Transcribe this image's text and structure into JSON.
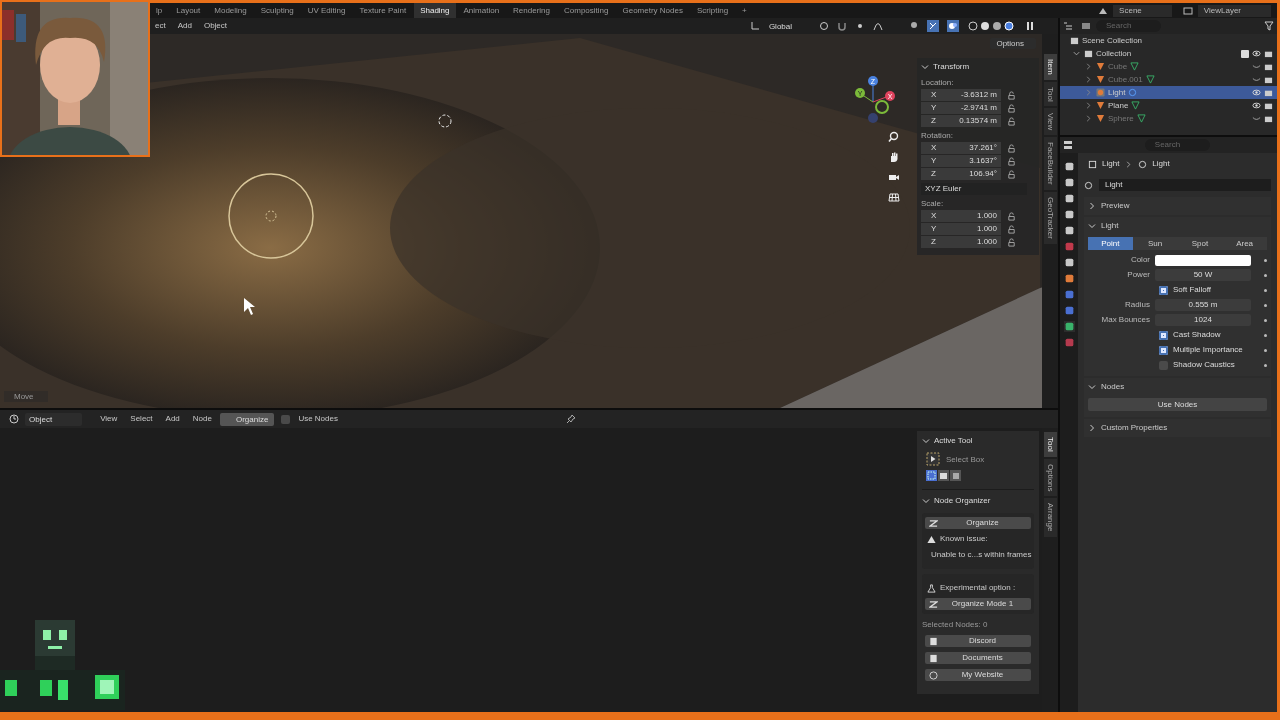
{
  "top_menu_fragment": "lp",
  "workspace_tabs": [
    {
      "label": "Layout",
      "selected": false
    },
    {
      "label": "Modeling",
      "selected": false
    },
    {
      "label": "Sculpting",
      "selected": false
    },
    {
      "label": "UV Editing",
      "selected": false
    },
    {
      "label": "Texture Paint",
      "selected": false
    },
    {
      "label": "Shading",
      "selected": true
    },
    {
      "label": "Animation",
      "selected": false
    },
    {
      "label": "Rendering",
      "selected": false
    },
    {
      "label": "Compositing",
      "selected": false
    },
    {
      "label": "Geometry Nodes",
      "selected": false
    },
    {
      "label": "Scripting",
      "selected": false
    }
  ],
  "add_tab": "+",
  "scene": "Scene",
  "view_layer": "ViewLayer",
  "viewport": {
    "menu": [
      "ect",
      "Add",
      "Object"
    ],
    "orientation": "Global",
    "options": "Options",
    "operator": "Move",
    "gizmo_axes": [
      "Z",
      "Y",
      "X"
    ],
    "transform": {
      "title": "Transform",
      "expanded": true,
      "location_label": "Location:",
      "location": [
        {
          "axis": "X",
          "value": "-3.6312 m"
        },
        {
          "axis": "Y",
          "value": "-2.9741 m"
        },
        {
          "axis": "Z",
          "value": "0.13574 m"
        }
      ],
      "rotation_label": "Rotation:",
      "rotation": [
        {
          "axis": "X",
          "value": "37.261°"
        },
        {
          "axis": "Y",
          "value": "3.1637°"
        },
        {
          "axis": "Z",
          "value": "106.94°"
        }
      ],
      "rotation_mode": "XYZ Euler",
      "scale_label": "Scale:",
      "scale": [
        {
          "axis": "X",
          "value": "1.000"
        },
        {
          "axis": "Y",
          "value": "1.000"
        },
        {
          "axis": "Z",
          "value": "1.000"
        }
      ]
    },
    "side_tabs": [
      {
        "label": "Item",
        "selected": true
      },
      {
        "label": "Tool",
        "selected": false
      },
      {
        "label": "View",
        "selected": false
      },
      {
        "label": "FaceBuilder",
        "selected": false
      },
      {
        "label": "GeoTracker",
        "selected": false
      }
    ]
  },
  "node_editor": {
    "editor_type": "Object",
    "menu": [
      "View",
      "Select",
      "Add",
      "Node"
    ],
    "organize": {
      "label": "Organize",
      "selected": true
    },
    "use_nodes": {
      "label": "Use Nodes",
      "checked": false
    },
    "active_tool": {
      "title": "Active Tool",
      "expanded": true,
      "tool": "Select Box"
    },
    "node_organizer": {
      "title": "Node Organizer",
      "expanded": true,
      "organize": "Organize",
      "issue_title": "Known issue:",
      "issue_text": "Unable to c...s within frames",
      "experimental": "Experimental option :",
      "mode_button": "Organize Mode 1",
      "selected_nodes": "Selected Nodes: 0",
      "links": [
        "Discord",
        "Documents",
        "My Website"
      ]
    },
    "side_tabs": [
      {
        "label": "Tool",
        "selected": true
      },
      {
        "label": "Options",
        "selected": false
      },
      {
        "label": "Arrange",
        "selected": false
      }
    ]
  },
  "outliner": {
    "search_placeholder": "Search",
    "scene_collection": "Scene Collection",
    "collection": "Collection",
    "collection_checked": true,
    "objects": [
      {
        "name": "Cube",
        "kind": "mesh",
        "visible": false,
        "selected": false
      },
      {
        "name": "Cube.001",
        "kind": "mesh",
        "visible": false,
        "selected": false
      },
      {
        "name": "Light",
        "kind": "light",
        "visible": true,
        "selected": true
      },
      {
        "name": "Plane",
        "kind": "mesh",
        "visible": true,
        "selected": false
      },
      {
        "name": "Sphere",
        "kind": "mesh",
        "visible": false,
        "selected": false
      }
    ]
  },
  "properties": {
    "search_placeholder": "Search",
    "breadcrumb": [
      "Light",
      "Light"
    ],
    "data_name": "Light",
    "preview": {
      "title": "Preview",
      "expanded": false
    },
    "light": {
      "title": "Light",
      "expanded": true,
      "types": [
        {
          "label": "Point",
          "selected": true
        },
        {
          "label": "Sun",
          "selected": false
        },
        {
          "label": "Spot",
          "selected": false
        },
        {
          "label": "Area",
          "selected": false
        }
      ],
      "settings": [
        {
          "kind": "color",
          "label": "Color"
        },
        {
          "kind": "field",
          "label": "Power",
          "value": "50 W"
        },
        {
          "kind": "checkbox",
          "label": "Soft Falloff",
          "checked": true
        },
        {
          "kind": "field",
          "label": "Radius",
          "value": "0.555 m"
        },
        {
          "kind": "field",
          "label": "Max Bounces",
          "value": "1024"
        },
        {
          "kind": "checkbox",
          "label": "Cast Shadow",
          "checked": true
        },
        {
          "kind": "checkbox",
          "label": "Multiple Importance",
          "checked": true
        },
        {
          "kind": "checkbox",
          "label": "Shadow Caustics",
          "checked": false
        }
      ]
    },
    "nodes": {
      "title": "Nodes",
      "expanded": true,
      "button": "Use Nodes"
    },
    "custom": {
      "title": "Custom Properties",
      "expanded": false
    }
  }
}
